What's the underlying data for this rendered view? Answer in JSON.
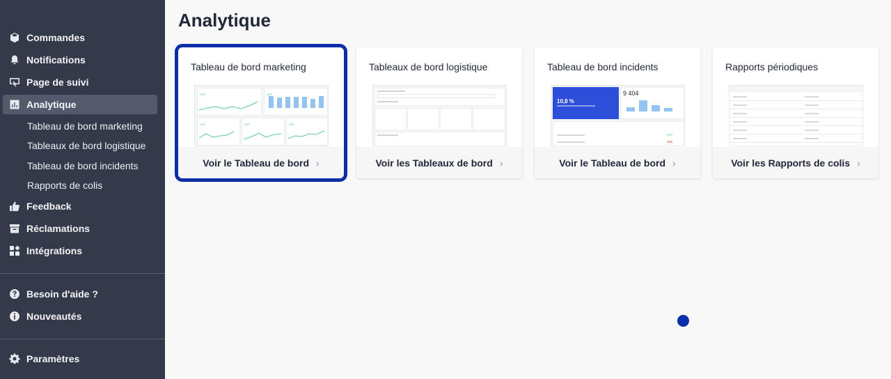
{
  "sidebar": {
    "items": [
      {
        "label": "Commandes",
        "icon": "box-icon"
      },
      {
        "label": "Notifications",
        "icon": "bell-icon"
      },
      {
        "label": "Page de suivi",
        "icon": "tracking-page-icon"
      },
      {
        "label": "Analytique",
        "icon": "chart-icon",
        "active": true
      },
      {
        "label": "Feedback",
        "icon": "thumbs-up-icon"
      },
      {
        "label": "Réclamations",
        "icon": "archive-icon"
      },
      {
        "label": "Intégrations",
        "icon": "grid-icon"
      },
      {
        "label": "Besoin d'aide ?",
        "icon": "question-icon"
      },
      {
        "label": "Nouveautés",
        "icon": "info-icon"
      },
      {
        "label": "Paramètres",
        "icon": "gear-icon"
      }
    ],
    "subitems": [
      "Tableau de bord marketing",
      "Tableaux de bord logistique",
      "Tableau de bord incidents",
      "Rapports de colis"
    ]
  },
  "main": {
    "title": "Analytique",
    "cards": [
      {
        "title": "Tableau de bord marketing",
        "action": "Voir le Tableau de bord"
      },
      {
        "title": "Tableaux de bord logistique",
        "action": "Voir les Tableaux de bord"
      },
      {
        "title": "Tableau de bord incidents",
        "action": "Voir le Tableau de bord",
        "preview_rate": "10,8 %",
        "preview_count": "9 404"
      },
      {
        "title": "Rapports périodiques",
        "action": "Voir les Rapports de colis"
      }
    ]
  },
  "colors": {
    "sidebar_bg": "#353a4a",
    "active_bg": "#545a6c",
    "accent": "#0a2ea8",
    "background": "#f8f8f9"
  }
}
